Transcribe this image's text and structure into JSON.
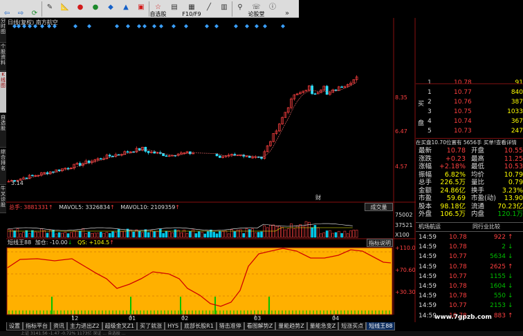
{
  "toolbar": {
    "items": [
      {
        "icon": "back-arrow",
        "label": ""
      },
      {
        "icon": "forward-arrow",
        "label": ""
      },
      {
        "icon": "refresh",
        "label": ""
      },
      {
        "icon": "modify",
        "label": "修正"
      },
      {
        "icon": "ruler",
        "label": "测缮"
      },
      {
        "icon": "buy",
        "label": "买入"
      },
      {
        "icon": "sell",
        "label": "卖出"
      },
      {
        "icon": "fund",
        "label": "基金"
      },
      {
        "icon": "simulate",
        "label": "模拟"
      },
      {
        "icon": "open-account",
        "label": "开户"
      },
      {
        "icon": "self-select",
        "label": "自选股"
      },
      {
        "icon": "period",
        "label": "周期"
      },
      {
        "icon": "f10",
        "label": "F10/F9"
      },
      {
        "icon": "draw-line",
        "label": "画线"
      },
      {
        "icon": "indicator",
        "label": "指标"
      },
      {
        "icon": "stock-select",
        "label": "选股"
      },
      {
        "icon": "forum",
        "label": "论股堂"
      },
      {
        "icon": "info",
        "label": "资讯"
      },
      {
        "icon": "more",
        "label": ""
      }
    ]
  },
  "sidetabs": [
    "分时图",
    "个股资料",
    "K线图",
    "自选股",
    "综合排名",
    "牛叉诊股"
  ],
  "chart": {
    "title": "日线(复权) 南方航空",
    "price_ticks": [
      "8.35",
      "6.47",
      "4.57",
      "3.14"
    ],
    "cai_label": "财",
    "vol_label_prefix": "总手: ",
    "vol_value": "3881331",
    "mavol5": "MAVOL5: 3326834",
    "mavol10": "MAVOL10: 2109359",
    "vol_button": "成交量",
    "vol_ticks": [
      "75002",
      "37521",
      "X100"
    ],
    "ind_name": "短线王88",
    "ind_add": "加仓: -10.00",
    "ind_qs": "QS: +104.5",
    "ind_button": "指标说明",
    "ind_ticks": [
      "+110.0",
      "+70.60",
      "+30.30"
    ],
    "month_labels": [
      "12",
      "01",
      "02",
      "03",
      "04"
    ]
  },
  "bottom_tabs": [
    "设置",
    "指标平台",
    "资讯",
    "主力进出Z2",
    "超级金叉Z1",
    "买了就涨",
    "HYS",
    "底部长股R1",
    "猎击准停",
    "看图解势Z",
    "量能趋势Z",
    "量能急变Z",
    "短涨买点",
    "短线王88"
  ],
  "statusbar": "上证 3141.56 -1.47 -0.72% 1173亿 深证 ... 自选股 ...",
  "order_book": [
    {
      "side": "",
      "n": "1",
      "price": "10.78",
      "vol": "91"
    },
    {
      "side": "",
      "n": "1",
      "price": "10.77",
      "vol": "840"
    },
    {
      "side": "买",
      "n": "2",
      "price": "10.76",
      "vol": "387"
    },
    {
      "side": "",
      "n": "3",
      "price": "10.75",
      "vol": "1033"
    },
    {
      "side": "盘",
      "n": "4",
      "price": "10.74",
      "vol": "367"
    },
    {
      "side": "",
      "n": "5",
      "price": "10.73",
      "vol": "247"
    }
  ],
  "buy_info": "在买盘10.70位置有 5656手 买单!查看详情",
  "stats": [
    [
      "最新",
      "10.78",
      "开盘",
      "10.55"
    ],
    [
      "涨跌",
      "+0.23",
      "最高",
      "11.25"
    ],
    [
      "涨幅",
      "+2.18%",
      "最低",
      "10.53"
    ],
    [
      "振幅",
      "6.82%",
      "均价",
      "10.79"
    ],
    [
      "总手",
      "226.5万",
      "量比",
      "0.79"
    ],
    [
      "金额",
      "24.86亿",
      "换手",
      "3.23%"
    ],
    [
      "市盈",
      "59.69",
      "市盈(动)",
      "13.90"
    ],
    [
      "股本",
      "98.18亿",
      "流通",
      "70.23亿"
    ],
    [
      "外盘",
      "106.5万",
      "内盘",
      "120.1万"
    ]
  ],
  "sector_tabs": [
    "机场航运",
    "同行业比较"
  ],
  "ticks": [
    {
      "t": "14:59",
      "p": "10.78",
      "v": "922",
      "d": "sell"
    },
    {
      "t": "14:59",
      "p": "10.78",
      "v": "2",
      "d": "buy"
    },
    {
      "t": "14:59",
      "p": "10.77",
      "v": "5634",
      "d": "buy"
    },
    {
      "t": "14:59",
      "p": "10.78",
      "v": "2625",
      "d": "sell"
    },
    {
      "t": "14:59",
      "p": "10.77",
      "v": "1155",
      "d": "buy"
    },
    {
      "t": "14:59",
      "p": "10.78",
      "v": "1604",
      "d": "buy"
    },
    {
      "t": "14:59",
      "p": "10.78",
      "v": "550",
      "d": "buy"
    },
    {
      "t": "14:59",
      "p": "10.77",
      "v": "2153",
      "d": "buy"
    },
    {
      "t": "14:59",
      "p": "10.78",
      "v": "883",
      "d": "sell"
    }
  ],
  "watermark": "www.7gpzb.com",
  "colors": {
    "background": "#000000",
    "up": "#ff4040",
    "down": "#00c000",
    "indicator_fill": "#ffb000",
    "indicator_line": "#d00000",
    "volume_bar": "#00c8e8"
  }
}
